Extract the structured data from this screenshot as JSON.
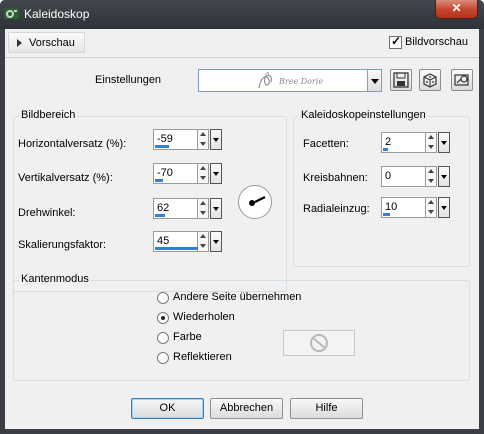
{
  "window": {
    "title": "Kaleidoskop",
    "close_symbol": "✕"
  },
  "preview": {
    "label": "Vorschau",
    "image_preview_label": "Bildvorschau",
    "image_preview_checked": true
  },
  "settings": {
    "label": "Einstellungen",
    "preset_watermark_text": "Bree Dorie"
  },
  "bildbereich": {
    "title": "Bildbereich",
    "horizontal": {
      "label": "Horizontalversatz (%):",
      "value": "-59",
      "level": 0.2
    },
    "vertical": {
      "label": "Vertikalversatz (%):",
      "value": "-70",
      "level": 0.15
    },
    "rotation": {
      "label": "Drehwinkel:",
      "value": "62",
      "level": 0.17
    },
    "scale": {
      "label": "Skalierungsfaktor:",
      "value": "45",
      "level": 0.95
    }
  },
  "kaleido": {
    "title": "Kaleidoskopeinstellungen",
    "facets": {
      "label": "Facetten:",
      "value": "2",
      "level": 0.1
    },
    "orbits": {
      "label": "Kreisbahnen:",
      "value": "0",
      "level": 0.0
    },
    "radial": {
      "label": "Radialeinzug:",
      "value": "10",
      "level": 0.15
    }
  },
  "edge_mode": {
    "title": "Kantenmodus",
    "options": [
      "Andere Seite übernehmen",
      "Wiederholen",
      "Farbe",
      "Reflektieren"
    ],
    "selected": "Wiederholen"
  },
  "buttons": {
    "ok": "OK",
    "cancel": "Abbrechen",
    "help": "Hilfe"
  },
  "icons": [
    "app-icon",
    "save-icon",
    "dice-icon",
    "preset-manager-icon",
    "no-color-icon"
  ]
}
